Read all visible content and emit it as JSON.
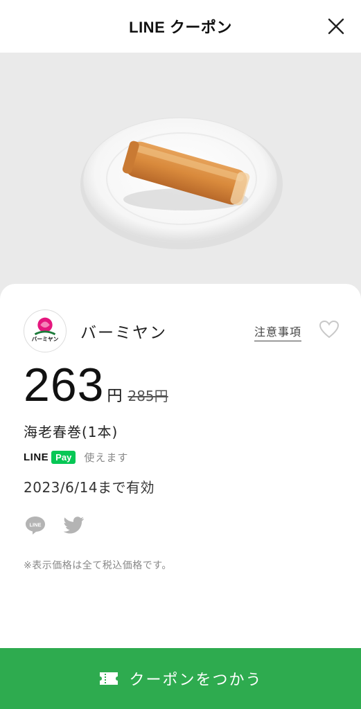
{
  "header": {
    "title": "LINE クーポン"
  },
  "store": {
    "name": "バーミヤン",
    "logo_text": "バーミヤン",
    "notice_label": "注意事項"
  },
  "offer": {
    "price": "263",
    "price_unit": "円",
    "original_price": "285円",
    "product": "海老春巻(1本)",
    "pay_brand": "LINE",
    "pay_badge": "Pay",
    "pay_note": "使えます",
    "expiry": "2023/6/14まで有効",
    "tax_note": "※表示価格は全て税込価格です。"
  },
  "share": {
    "line_icon_text": "LINE"
  },
  "cta": {
    "label": "クーポンをつかう"
  },
  "colors": {
    "accent": "#2eab4f",
    "line_green": "#06c755"
  },
  "icons": [
    "close-icon",
    "heart-icon",
    "line-share-icon",
    "twitter-icon",
    "ticket-icon"
  ]
}
